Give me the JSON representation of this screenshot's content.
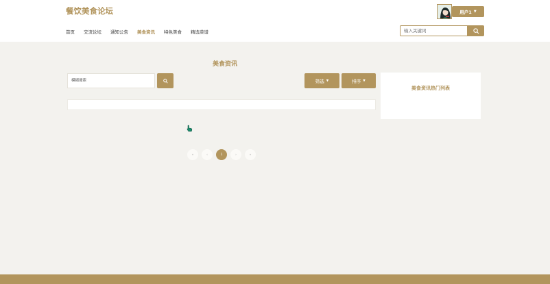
{
  "header": {
    "site_title": "餐饮美食论坛",
    "nav": [
      {
        "label": "首页"
      },
      {
        "label": "交流论坛"
      },
      {
        "label": "通知公告"
      },
      {
        "label": "美食资讯",
        "active": true
      },
      {
        "label": "特色美食"
      },
      {
        "label": "精选菜谱"
      }
    ],
    "user_label": "用户1",
    "search_placeholder": "输入关键词"
  },
  "main": {
    "section_title": "美食资讯",
    "fuzzy_search_placeholder": "模糊搜索",
    "filter_label": "筛选",
    "sort_label": "排序"
  },
  "sidebar": {
    "panel_title": "美食资讯热门列表"
  },
  "pagination": {
    "first": "«",
    "prev": "‹",
    "current_page": "1",
    "next": "›",
    "last": "»"
  },
  "colors": {
    "accent": "#b2955d",
    "background": "#f3f2ee",
    "surface": "#ffffff"
  },
  "icons": {
    "search": "search-icon",
    "caret": "caret-down-icon"
  }
}
